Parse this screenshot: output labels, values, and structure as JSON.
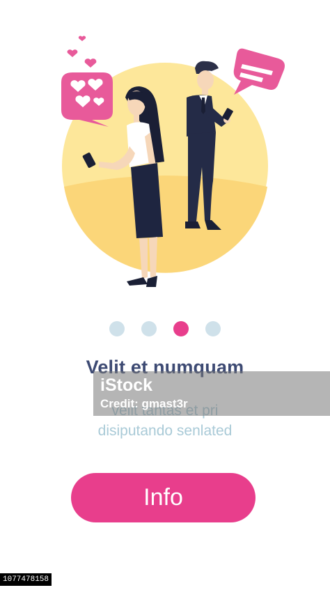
{
  "onboarding": {
    "title": "Velit et numquam",
    "subtitle_line1": "velit tantas et pri",
    "subtitle_line2": "disiputando senlated",
    "button_label": "Info",
    "pager": {
      "total": 4,
      "active_index": 2
    }
  },
  "watermark": {
    "brand": "iStock",
    "credit": "Credit: gmast3r"
  },
  "stock_id": "1077478158",
  "colors": {
    "accent_pink": "#e83e8c",
    "title_navy": "#3d4a73",
    "subtitle_blue": "#a9cad7",
    "dot_inactive": "#cfe1ea",
    "circle_yellow": "#fde79a"
  },
  "icons": [
    "heart-speech-bubble-icon",
    "text-speech-bubble-icon",
    "smartphone-icon"
  ]
}
